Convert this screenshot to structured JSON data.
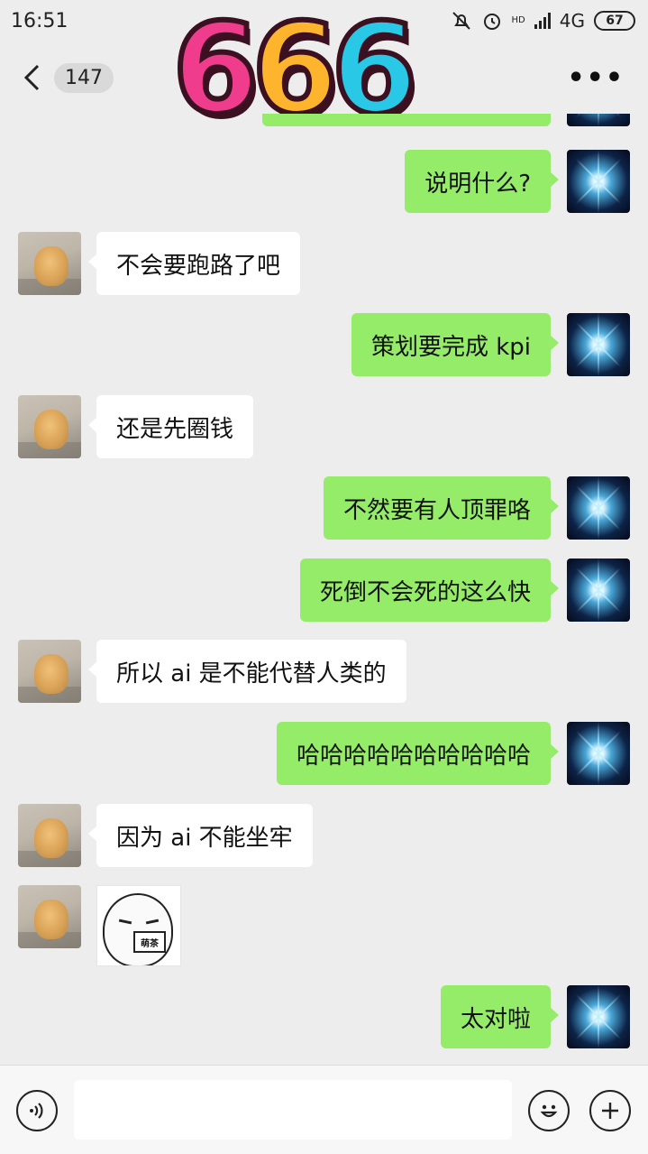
{
  "status_bar": {
    "time": "16:51",
    "network": "4G",
    "network_sub": "ıl",
    "hd": "HD",
    "battery": "67"
  },
  "nav": {
    "unread_count": "147",
    "more_label": "•••"
  },
  "sticker_overlay": [
    "6",
    "6",
    "6"
  ],
  "messages": [
    {
      "side": "right",
      "text": "说明什么?"
    },
    {
      "side": "left",
      "text": "不会要跑路了吧"
    },
    {
      "side": "right",
      "text": "策划要完成 kpi"
    },
    {
      "side": "left",
      "text": "还是先圈钱"
    },
    {
      "side": "right",
      "text": "不然要有人顶罪咯"
    },
    {
      "side": "right",
      "text": "死倒不会死的这么快"
    },
    {
      "side": "left",
      "text": "所以 ai 是不能代替人类的"
    },
    {
      "side": "right",
      "text": "哈哈哈哈哈哈哈哈哈哈"
    },
    {
      "side": "left",
      "text": "因为 ai 不能坐牢"
    },
    {
      "side": "left",
      "type": "sticker",
      "text": "萌茶"
    },
    {
      "side": "right",
      "text": "太对啦"
    }
  ],
  "input": {
    "placeholder": "",
    "voice_icon": "voice-icon",
    "emoji_icon": "emoji-icon",
    "plus_icon": "plus-icon"
  }
}
